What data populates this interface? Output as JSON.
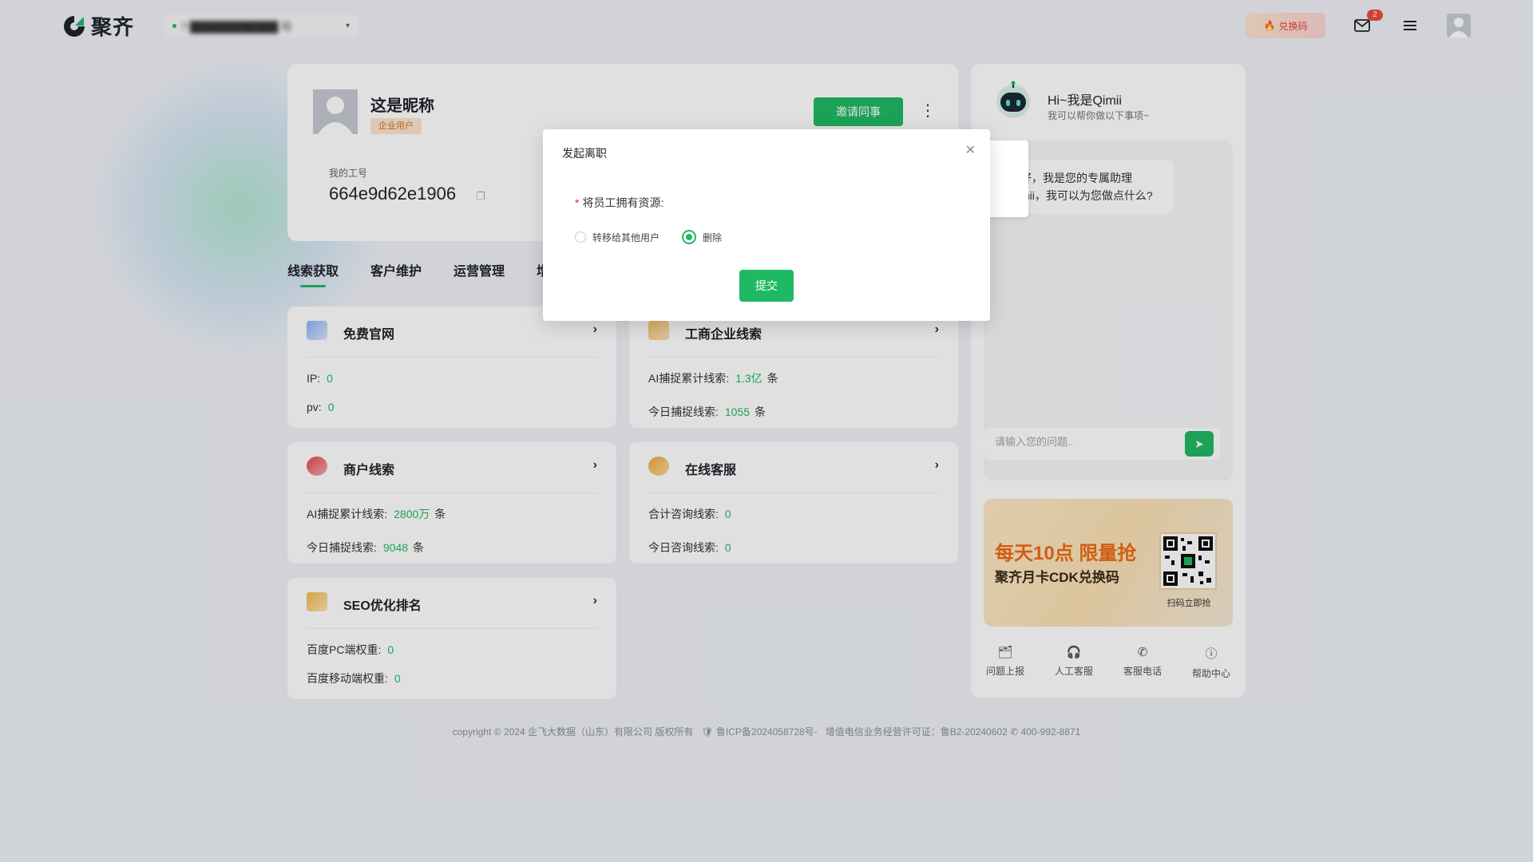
{
  "topbar": {
    "brand": "聚齐",
    "company_name": "? ████████████ 司",
    "redeem_label": "兑换码",
    "mail_badge": "2"
  },
  "profile": {
    "nickname": "这是昵称",
    "user_tag": "企业用户",
    "id_label": "我的工号",
    "id_value": "664e9d62e1906",
    "invite_label": "邀请同事",
    "more_label": "⋮"
  },
  "tabs": [
    "线索获取",
    "客户维护",
    "运营管理",
    "增"
  ],
  "modules": {
    "free_site": {
      "title": "免费官网",
      "stats": [
        {
          "label": "IP:",
          "value": "0",
          "unit": ""
        },
        {
          "label": "pv:",
          "value": "0",
          "unit": ""
        }
      ]
    },
    "business_leads": {
      "title": "工商企业线索",
      "stats": [
        {
          "label": "AI捕捉累计线索:",
          "value": "1.3亿",
          "unit": "条"
        },
        {
          "label": "今日捕捉线索:",
          "value": "1055",
          "unit": "条"
        }
      ]
    },
    "merchant_leads": {
      "title": "商户线索",
      "stats": [
        {
          "label": "AI捕捉累计线索:",
          "value": "2800万",
          "unit": "条"
        },
        {
          "label": "今日捕捉线索:",
          "value": "9048",
          "unit": "条"
        }
      ]
    },
    "online_service": {
      "title": "在线客服",
      "stats": [
        {
          "label": "合计咨询线索:",
          "value": "0",
          "unit": ""
        },
        {
          "label": "今日咨询线索:",
          "value": "0",
          "unit": ""
        }
      ]
    },
    "seo": {
      "title": "SEO优化排名",
      "stats": [
        {
          "label": "百度PC端权重:",
          "value": "0",
          "unit": ""
        },
        {
          "label": "百度移动端权重:",
          "value": "0",
          "unit": ""
        }
      ]
    }
  },
  "assistant": {
    "title": "Hi~我是Qimii",
    "subtitle": "我可以帮你做以下事项~",
    "message": "您好，我是您的专属助理Qimii，我可以为您做点什么?",
    "input_placeholder": "请输入您的问题..",
    "promo_line1": "每天10点 限量抢",
    "promo_line2": "聚齐月卡CDK兑换码",
    "promo_qr_label": "扫码立即抢",
    "quick_links": [
      "问题上报",
      "人工客服",
      "客服电话",
      "帮助中心"
    ]
  },
  "footer": {
    "copyright": "copyright © 2024 企飞大数据（山东）有限公司 版权所有",
    "icp": "鲁ICP备2024058728号-",
    "license": "增值电信业务经营许可证：鲁B2-20240602",
    "phone": "400-992-8871"
  },
  "dialog": {
    "title": "发起离职",
    "field_label": "将员工拥有资源:",
    "option_transfer": "转移给其他用户",
    "option_delete": "删除",
    "selected": "删除",
    "submit_label": "提交"
  },
  "colors": {
    "primary": "#1fb964",
    "accent_orange": "#ee6a16",
    "danger": "#f04a3e"
  }
}
